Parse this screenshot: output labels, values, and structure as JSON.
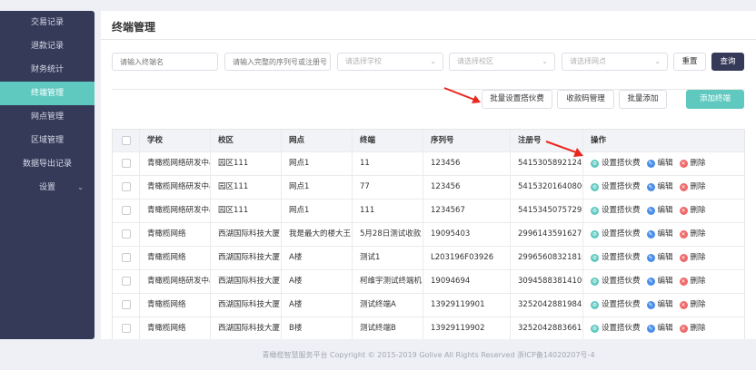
{
  "sidebar": {
    "items": [
      {
        "label": "交易记录",
        "active": false
      },
      {
        "label": "退款记录",
        "active": false
      },
      {
        "label": "财务统计",
        "active": false
      },
      {
        "label": "终端管理",
        "active": true
      },
      {
        "label": "网点管理",
        "active": false
      },
      {
        "label": "区域管理",
        "active": false
      },
      {
        "label": "数据导出记录",
        "active": false
      },
      {
        "label": "设置",
        "active": false,
        "expandable": true
      }
    ]
  },
  "page": {
    "title": "终端管理"
  },
  "filters": {
    "terminal_name_placeholder": "请输入终端名",
    "serial_placeholder": "请输入完整的序列号或注册号",
    "school_placeholder": "请选择学校",
    "campus_placeholder": "请选择校区",
    "site_placeholder": "请选择网点",
    "reset_label": "重置",
    "query_label": "查询"
  },
  "actions": {
    "batch_fee_label": "批量设置搭伙费",
    "payment_code_label": "收款码管理",
    "batch_add_label": "批量添加",
    "add_terminal_label": "添加终端"
  },
  "table": {
    "columns": [
      "学校",
      "校区",
      "网点",
      "终端",
      "序列号",
      "注册号",
      "操作"
    ],
    "row_actions": {
      "set_fee": "设置搭伙费",
      "edit": "编辑",
      "delete": "删除"
    },
    "rows": [
      [
        "青橄榄网络研发中心",
        "园区111",
        "网点1",
        "11",
        "123456",
        "54153058921241"
      ],
      [
        "青橄榄网络研发中心",
        "园区111",
        "网点1",
        "77",
        "123456",
        "54153201640800"
      ],
      [
        "青橄榄网络研发中心",
        "园区111",
        "网点1",
        "111",
        "1234567",
        "54153450757292"
      ],
      [
        "青橄榄网络",
        "西湖国际科技大厦",
        "我是最大的楼大王",
        "5月28日测试收款",
        "19095403",
        "29961435916271"
      ],
      [
        "青橄榄网络",
        "西湖国际科技大厦",
        "A楼",
        "测试1",
        "L203196F03926",
        "29965608321810"
      ],
      [
        "青橄榄网络研发中心",
        "西湖国际科技大厦",
        "A楼",
        "柯维宇测试终端机",
        "19094694",
        "30945883814100"
      ],
      [
        "青橄榄网络",
        "西湖国际科技大厦",
        "A楼",
        "测试终端A",
        "13929119901",
        "32520428819847"
      ],
      [
        "青橄榄网络",
        "西湖国际科技大厦",
        "B楼",
        "测试终端B",
        "13929119902",
        "32520428836613"
      ]
    ]
  },
  "footer": {
    "text": "青橄榄智慧服务平台 Copyright © 2015-2019 Golive All Rights Reserved  浙ICP备14020207号-4"
  },
  "colors": {
    "sidebar": "#343a58",
    "accent": "#5fc9c0",
    "annotation_arrow": "#e8281e"
  }
}
